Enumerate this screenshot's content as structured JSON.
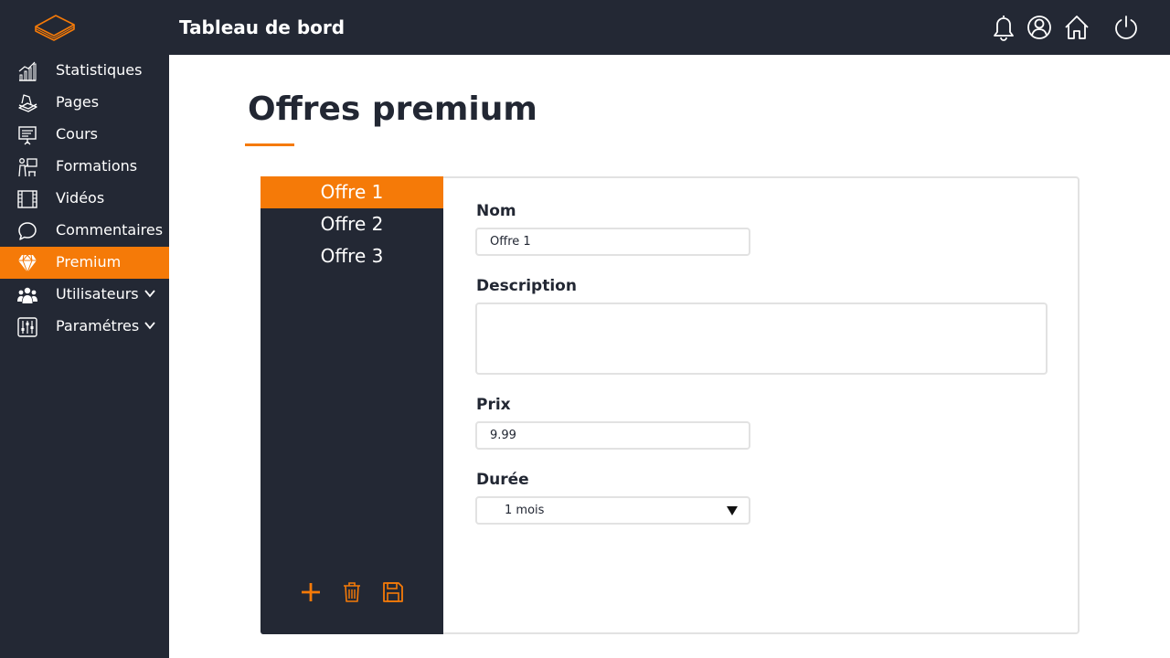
{
  "app": {
    "title": "Tableau de bord",
    "logo_icon": "book-logo-icon",
    "accent_color": "#f57a08",
    "dark_color": "#232834"
  },
  "topbar": {
    "icons": [
      "bell-icon",
      "user-icon",
      "home-icon",
      "power-icon"
    ]
  },
  "sidebar": {
    "items": [
      {
        "label": "Statistiques",
        "icon": "chart-icon",
        "active": false,
        "has_submenu": false
      },
      {
        "label": "Pages",
        "icon": "pages-icon",
        "active": false,
        "has_submenu": false
      },
      {
        "label": "Cours",
        "icon": "presentation-icon",
        "active": false,
        "has_submenu": false
      },
      {
        "label": "Formations",
        "icon": "training-icon",
        "active": false,
        "has_submenu": false
      },
      {
        "label": "Vidéos",
        "icon": "film-icon",
        "active": false,
        "has_submenu": false
      },
      {
        "label": "Commentaires",
        "icon": "comment-icon",
        "active": false,
        "has_submenu": false
      },
      {
        "label": "Premium",
        "icon": "diamond-icon",
        "active": true,
        "has_submenu": false
      },
      {
        "label": "Utilisateurs",
        "icon": "users-icon",
        "active": false,
        "has_submenu": true
      },
      {
        "label": "Paramétres",
        "icon": "sliders-icon",
        "active": false,
        "has_submenu": true
      }
    ]
  },
  "main": {
    "title": "Offres premium",
    "offers": [
      {
        "label": "Offre 1",
        "active": true
      },
      {
        "label": "Offre 2",
        "active": false
      },
      {
        "label": "Offre 3",
        "active": false
      }
    ],
    "list_actions": [
      "add-icon",
      "trash-icon",
      "save-icon"
    ],
    "form": {
      "name_label": "Nom",
      "name_value": "Offre 1",
      "description_label": "Description",
      "description_value": "",
      "price_label": "Prix",
      "price_value": "9.99",
      "duration_label": "Durée",
      "duration_value": "1 mois"
    }
  }
}
